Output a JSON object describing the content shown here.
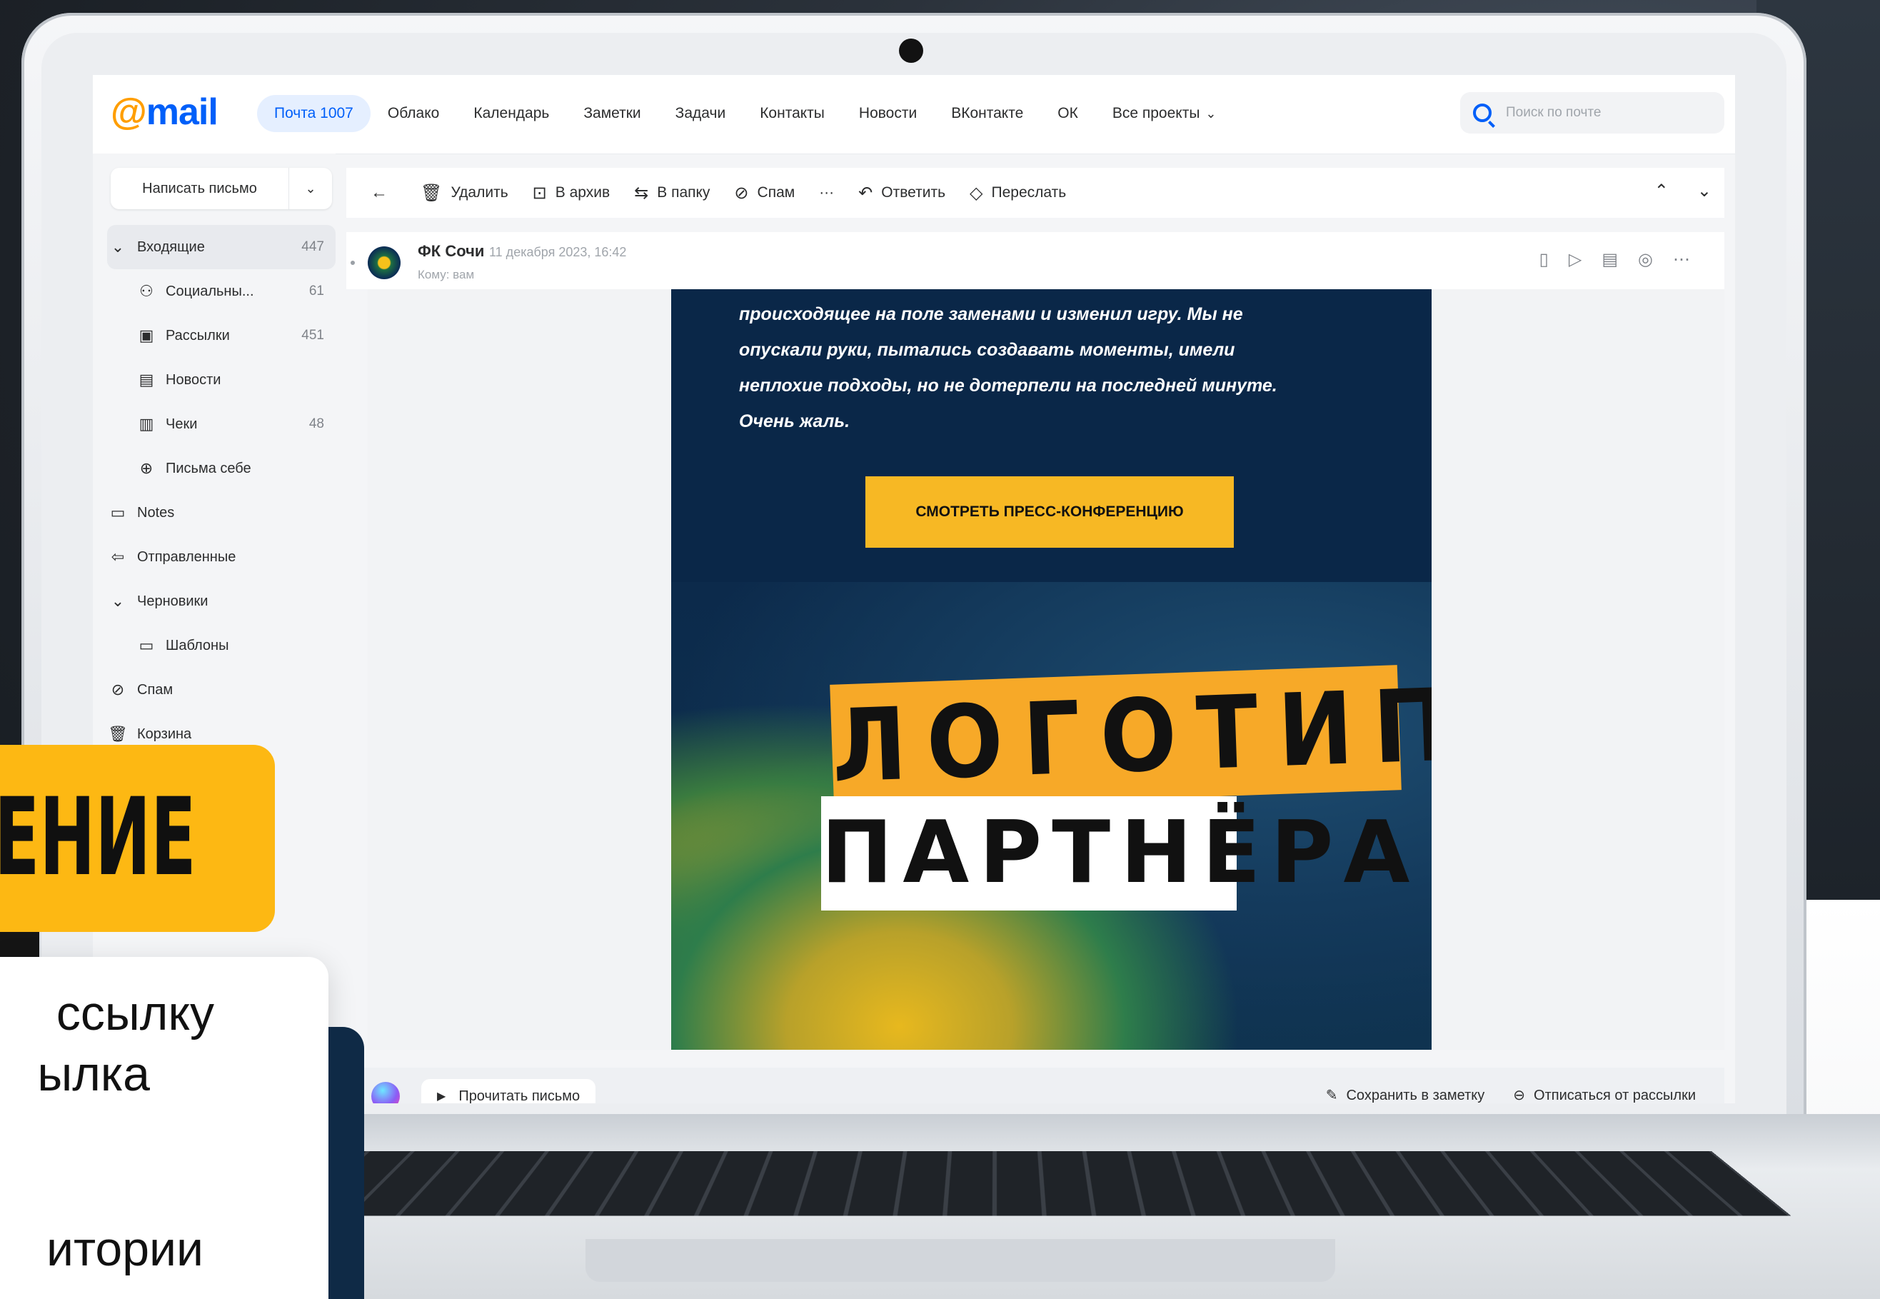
{
  "topbar": {
    "logo": "mail",
    "nav": [
      "Почта 1007",
      "Облако",
      "Календарь",
      "Заметки",
      "Задачи",
      "Контакты",
      "Новости",
      "ВКонтакте",
      "ОК",
      "Все проекты"
    ],
    "search_placeholder": "Поиск по почте"
  },
  "sidebar": {
    "compose": "Написать письмо",
    "folders": [
      {
        "label": "Входящие",
        "count": "447",
        "icon": "chevron-down"
      },
      {
        "label": "Социальны...",
        "count": "61",
        "icon": "people"
      },
      {
        "label": "Рассылки",
        "count": "451",
        "icon": "newsletter"
      },
      {
        "label": "Новости",
        "count": "",
        "icon": "news"
      },
      {
        "label": "Чеки",
        "count": "48",
        "icon": "receipt"
      },
      {
        "label": "Письма себе",
        "count": "",
        "icon": "self"
      },
      {
        "label": "Notes",
        "count": "",
        "icon": "folder"
      },
      {
        "label": "Отправленные",
        "count": "",
        "icon": "sent"
      },
      {
        "label": "Черновики",
        "count": "",
        "icon": "chevron-down"
      },
      {
        "label": "Шаблоны",
        "count": "",
        "icon": "folder"
      },
      {
        "label": "Спам",
        "count": "",
        "icon": "spam"
      },
      {
        "label": "Корзина",
        "count": "",
        "icon": "trash"
      }
    ]
  },
  "toolbar": {
    "delete": "Удалить",
    "archive": "В архив",
    "to_folder": "В папку",
    "spam": "Спам",
    "more": "···",
    "reply": "Ответить",
    "forward": "Переслать"
  },
  "mail": {
    "sender": "ФК Сочи",
    "date": "11 декабря 2023, 16:42",
    "to": "Кому: вам",
    "body_lines": [
      "происходящее на поле заменами и изменил игру. Мы не",
      "опускали руки, пытались создавать моменты, имели",
      "неплохие подходы, но не дотерпели на последней минуте.",
      "Очень жаль."
    ],
    "cta": "СМОТРЕТЬ ПРЕСС-КОНФЕРЕНЦИЮ",
    "logo_line1": "ЛОГОТИП",
    "logo_line2": "ПАРТНЁРА"
  },
  "bottombar": {
    "read": "Прочитать письмо",
    "save_note": "Сохранить в заметку",
    "unsubscribe": "Отписаться от рассылки"
  },
  "overlay": {
    "banner": "ЖЕНИЕ",
    "card_lines": [
      "ссылку",
      "ылка",
      "итории"
    ]
  }
}
